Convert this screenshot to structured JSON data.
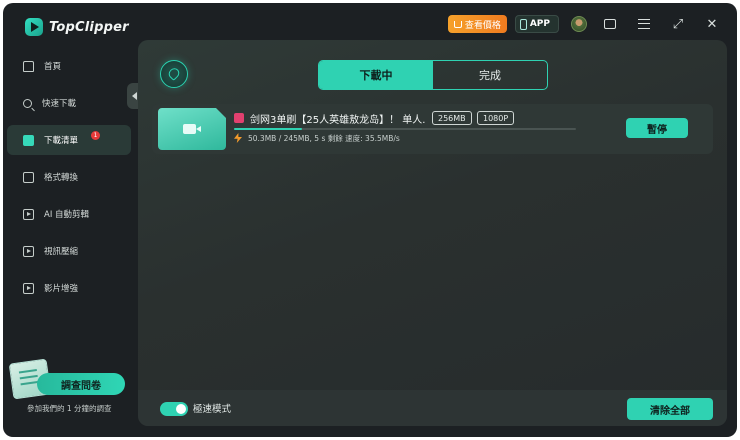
{
  "app": {
    "name": "TopClipper"
  },
  "titlebar": {
    "vip_label": "查看價格",
    "app_label": "APP"
  },
  "sidebar": {
    "items": [
      {
        "label": "首頁"
      },
      {
        "label": "快速下載"
      },
      {
        "label": "下載清單",
        "badge": "1"
      },
      {
        "label": "格式轉換"
      },
      {
        "label": "AI 自動剪輯"
      },
      {
        "label": "視訊壓縮"
      },
      {
        "label": "影片增強"
      }
    ],
    "survey": {
      "button_label": "調查問卷",
      "note": "參加我們的 1 分鐘的調查"
    }
  },
  "tabs": [
    {
      "label": "下載中",
      "active": true
    },
    {
      "label": "完成",
      "active": false
    }
  ],
  "downloads": [
    {
      "title": "剑网3单刷【25人英雄敖龙岛】！ 单人...",
      "size": "256MB",
      "resolution": "1080P",
      "status": "50.3MB / 245MB, 5 s 剩餘  速度: 35.5MB/s",
      "progress": 0.2,
      "action_label": "暫停"
    }
  ],
  "footer": {
    "turbo_label": "極速模式",
    "turbo_on": true,
    "clear_label": "清除全部"
  },
  "colors": {
    "accent": "#2fd2b2",
    "background": "#1c2023",
    "panel": "#2a302f",
    "vip": "#f39a2b"
  }
}
